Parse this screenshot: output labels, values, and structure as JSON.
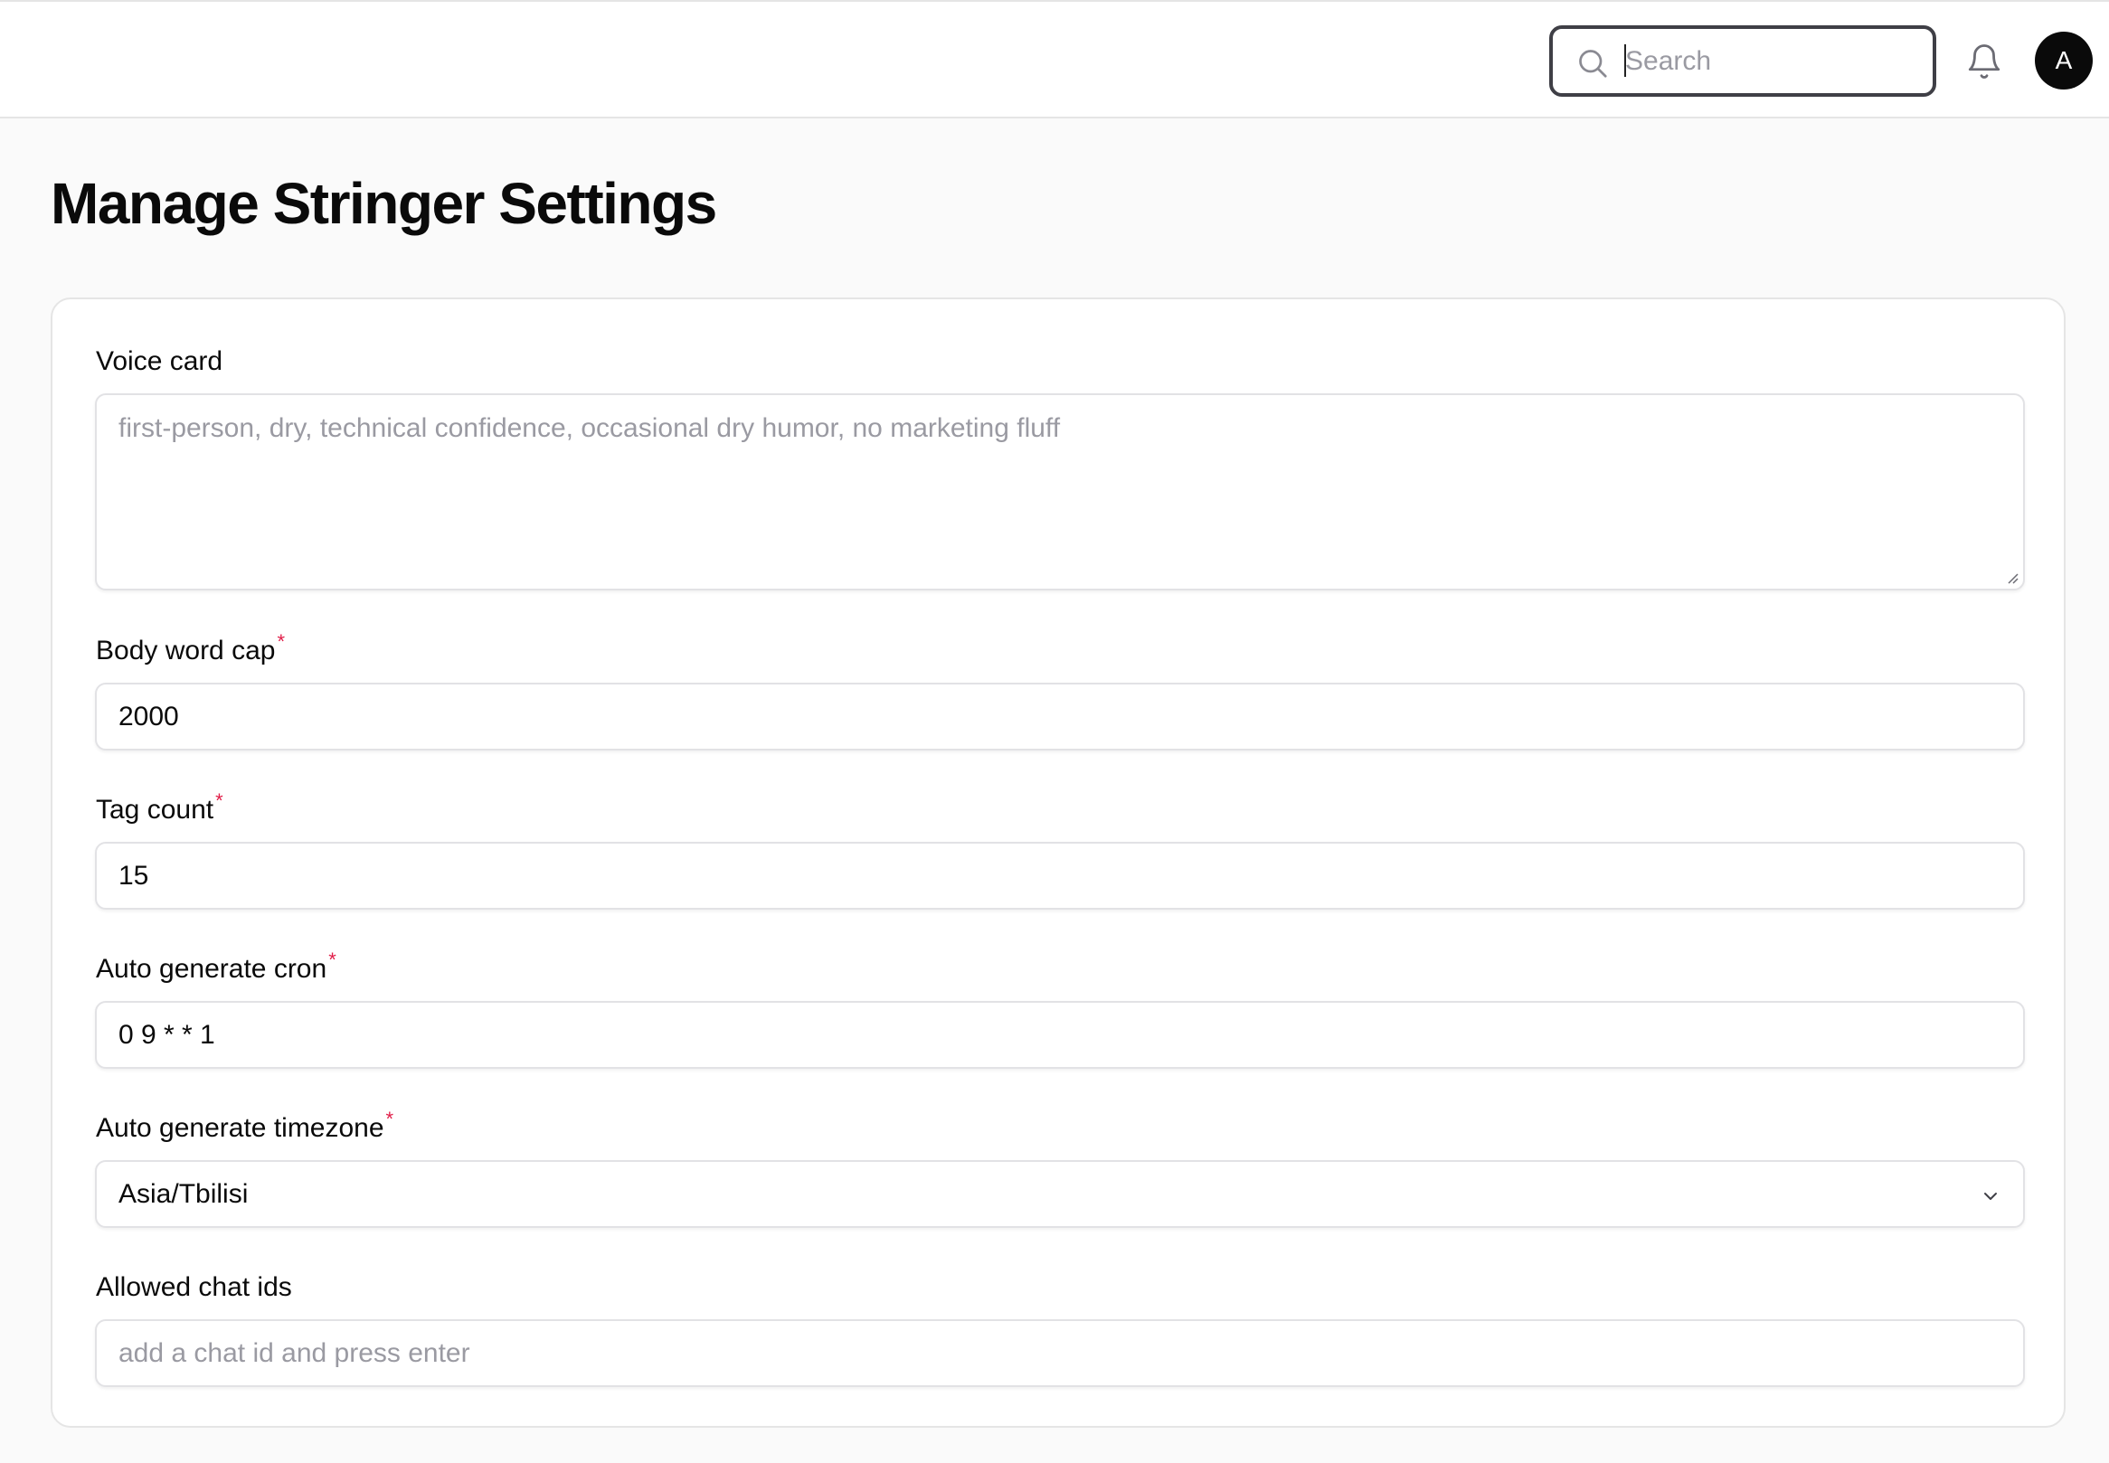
{
  "header": {
    "search_placeholder": "Search",
    "avatar_initial": "A"
  },
  "page": {
    "title": "Manage Stringer Settings"
  },
  "form": {
    "voice_card": {
      "label": "Voice card",
      "placeholder": "first-person, dry, technical confidence, occasional dry humor, no marketing fluff",
      "value": ""
    },
    "body_word_cap": {
      "label": "Body word cap",
      "required_mark": "*",
      "value": "2000"
    },
    "tag_count": {
      "label": "Tag count",
      "required_mark": "*",
      "value": "15"
    },
    "auto_generate_cron": {
      "label": "Auto generate cron",
      "required_mark": "*",
      "value": "0 9 * * 1"
    },
    "auto_generate_timezone": {
      "label": "Auto generate timezone",
      "required_mark": "*",
      "value": "Asia/Tbilisi"
    },
    "allowed_chat_ids": {
      "label": "Allowed chat ids",
      "placeholder": "add a chat id and press enter"
    }
  },
  "colors": {
    "accent_dark": "#0a0a0a",
    "required": "#e11d48",
    "border": "#e2e2e5",
    "page_bg": "#fafafa"
  },
  "icons": {
    "search": "search-icon",
    "notifications": "bell-icon",
    "select_caret": "chevron-down-icon"
  }
}
